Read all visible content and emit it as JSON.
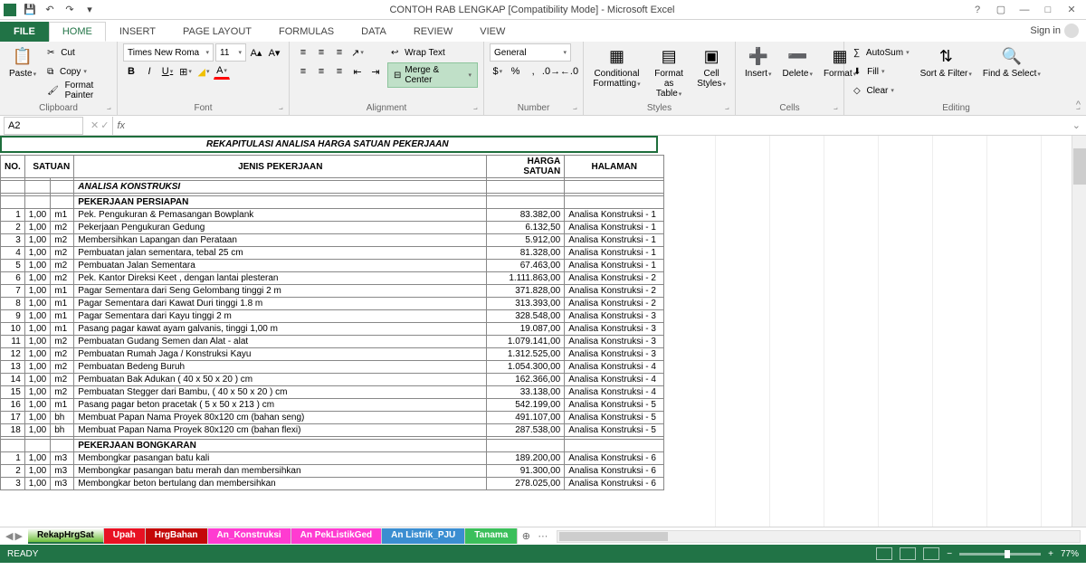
{
  "title": "CONTOH RAB LENGKAP  [Compatibility Mode] - Microsoft Excel",
  "signin": "Sign in",
  "tabs": {
    "file": "FILE",
    "home": "HOME",
    "insert": "INSERT",
    "pagelayout": "PAGE LAYOUT",
    "formulas": "FORMULAS",
    "data": "DATA",
    "review": "REVIEW",
    "view": "VIEW"
  },
  "clipboard": {
    "paste": "Paste",
    "cut": "Cut",
    "copy": "Copy",
    "painter": "Format Painter",
    "label": "Clipboard"
  },
  "font": {
    "name": "Times New Roma",
    "size": "11",
    "label": "Font"
  },
  "alignment": {
    "wrap": "Wrap Text",
    "merge": "Merge & Center",
    "label": "Alignment"
  },
  "number": {
    "format": "General",
    "label": "Number"
  },
  "styles": {
    "cf": "Conditional Formatting",
    "fat": "Format as Table",
    "cs": "Cell Styles",
    "label": "Styles"
  },
  "cells": {
    "insert": "Insert",
    "delete": "Delete",
    "format": "Format",
    "label": "Cells"
  },
  "editing": {
    "autosum": "AutoSum",
    "fill": "Fill",
    "clear": "Clear",
    "sort": "Sort & Filter",
    "find": "Find & Select",
    "label": "Editing"
  },
  "namebox": "A2",
  "sheet": {
    "title": "REKAPITULASI  ANALISA  HARGA  SATUAN  PEKERJAAN",
    "headers": {
      "no": "NO.",
      "sat": "SATUAN",
      "jenis": "JENIS PEKERJAAN",
      "harga": "HARGA SATUAN",
      "hal": "HALAMAN"
    },
    "section1": "ANALISA  KONSTRUKSI",
    "sub1": "PEKERJAAN PERSIAPAN",
    "rows1": [
      {
        "no": "1",
        "vol": "1,00",
        "sat": "m1",
        "jenis": "Pek. Pengukuran  & Pemasangan Bowplank",
        "harga": "83.382,00",
        "hal": "Analisa Konstruksi - 1"
      },
      {
        "no": "2",
        "vol": "1,00",
        "sat": "m2",
        "jenis": "Pekerjaan Pengukuran Gedung",
        "harga": "6.132,50",
        "hal": "Analisa Konstruksi - 1"
      },
      {
        "no": "3",
        "vol": "1,00",
        "sat": "m2",
        "jenis": "Membersihkan Lapangan dan Perataan",
        "harga": "5.912,00",
        "hal": "Analisa Konstruksi - 1"
      },
      {
        "no": "4",
        "vol": "1,00",
        "sat": "m2",
        "jenis": "Pembuatan jalan sementara, tebal 25 cm",
        "harga": "81.328,00",
        "hal": "Analisa Konstruksi - 1"
      },
      {
        "no": "5",
        "vol": "1,00",
        "sat": "m2",
        "jenis": "Pembuatan Jalan Sementara",
        "harga": "67.463,00",
        "hal": "Analisa Konstruksi - 1"
      },
      {
        "no": "6",
        "vol": "1,00",
        "sat": "m2",
        "jenis": "Pek. Kantor Direksi Keet , dengan lantai plesteran",
        "harga": "1.111.863,00",
        "hal": "Analisa Konstruksi - 2"
      },
      {
        "no": "7",
        "vol": "1,00",
        "sat": "m1",
        "jenis": "Pagar Sementara dari Seng Gelombang tinggi 2 m",
        "harga": "371.828,00",
        "hal": "Analisa Konstruksi - 2"
      },
      {
        "no": "8",
        "vol": "1,00",
        "sat": "m1",
        "jenis": "Pagar Sementara dari Kawat Duri tinggi 1.8 m",
        "harga": "313.393,00",
        "hal": "Analisa Konstruksi - 2"
      },
      {
        "no": "9",
        "vol": "1,00",
        "sat": "m1",
        "jenis": "Pagar Sementara dari Kayu tinggi 2 m",
        "harga": "328.548,00",
        "hal": "Analisa Konstruksi - 3"
      },
      {
        "no": "10",
        "vol": "1,00",
        "sat": "m1",
        "jenis": "Pasang pagar kawat ayam galvanis, tinggi 1,00 m",
        "harga": "19.087,00",
        "hal": "Analisa Konstruksi - 3"
      },
      {
        "no": "11",
        "vol": "1,00",
        "sat": "m2",
        "jenis": "Pembuatan Gudang Semen dan Alat - alat",
        "harga": "1.079.141,00",
        "hal": "Analisa Konstruksi - 3"
      },
      {
        "no": "12",
        "vol": "1,00",
        "sat": "m2",
        "jenis": "Pembuatan Rumah Jaga / Konstruksi Kayu",
        "harga": "1.312.525,00",
        "hal": "Analisa Konstruksi - 3"
      },
      {
        "no": "13",
        "vol": "1,00",
        "sat": "m2",
        "jenis": "Pembuatan Bedeng Buruh",
        "harga": "1.054.300,00",
        "hal": "Analisa Konstruksi - 4"
      },
      {
        "no": "14",
        "vol": "1,00",
        "sat": "m2",
        "jenis": "Pembuatan Bak Adukan ( 40 x 50 x 20 ) cm",
        "harga": "162.366,00",
        "hal": "Analisa Konstruksi - 4"
      },
      {
        "no": "15",
        "vol": "1,00",
        "sat": "m2",
        "jenis": "Pembuatan Stegger dari Bambu, ( 40 x 50 x 20 ) cm",
        "harga": "33.138,00",
        "hal": "Analisa Konstruksi - 4"
      },
      {
        "no": "16",
        "vol": "1,00",
        "sat": "m1",
        "jenis": "Pasang pagar beton pracetak ( 5 x 50 x 213 ) cm",
        "harga": "542.199,00",
        "hal": "Analisa Konstruksi - 5"
      },
      {
        "no": "17",
        "vol": "1,00",
        "sat": "bh",
        "jenis": "Membuat Papan Nama Proyek 80x120 cm (bahan seng)",
        "harga": "491.107,00",
        "hal": "Analisa Konstruksi - 5"
      },
      {
        "no": "18",
        "vol": "1,00",
        "sat": "bh",
        "jenis": "Membuat Papan Nama Proyek 80x120 cm (bahan flexi)",
        "harga": "287.538,00",
        "hal": "Analisa Konstruksi - 5"
      }
    ],
    "sub2": "PEKERJAAN BONGKARAN",
    "rows2": [
      {
        "no": "1",
        "vol": "1,00",
        "sat": "m3",
        "jenis": "Membongkar pasangan batu kali",
        "harga": "189.200,00",
        "hal": "Analisa Konstruksi - 6"
      },
      {
        "no": "2",
        "vol": "1,00",
        "sat": "m3",
        "jenis": "Membongkar pasangan batu merah dan membersihkan",
        "harga": "91.300,00",
        "hal": "Analisa Konstruksi - 6"
      },
      {
        "no": "3",
        "vol": "1,00",
        "sat": "m3",
        "jenis": "Membongkar beton bertulang dan membersihkan",
        "harga": "278.025,00",
        "hal": "Analisa Konstruksi - 6"
      }
    ]
  },
  "sheetTabs": [
    {
      "label": "RekapHrgSat",
      "bg": "#6fbf3b",
      "fg": "#000",
      "bold": true,
      "active": true
    },
    {
      "label": "Upah",
      "bg": "#e81123",
      "fg": "#fff"
    },
    {
      "label": "HrgBahan",
      "bg": "#c40808",
      "fg": "#fff"
    },
    {
      "label": "An_Konstruksi",
      "bg": "#ff3bd1",
      "fg": "#fff"
    },
    {
      "label": "An PekListikGed",
      "bg": "#ff3bd1",
      "fg": "#fff"
    },
    {
      "label": "An Listrik_PJU",
      "bg": "#3b8ed1",
      "fg": "#fff"
    },
    {
      "label": "Tanama",
      "bg": "#3bbf5b",
      "fg": "#fff"
    }
  ],
  "status": {
    "ready": "READY",
    "zoom": "77%"
  }
}
